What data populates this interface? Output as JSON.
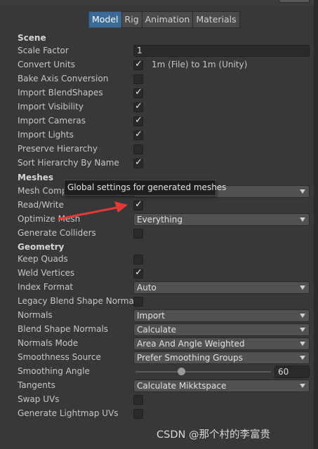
{
  "tabs": [
    {
      "label": "Model",
      "active": true
    },
    {
      "label": "Rig",
      "active": false
    },
    {
      "label": "Animation",
      "active": false
    },
    {
      "label": "Materials",
      "active": false
    }
  ],
  "scene": {
    "header": "Scene",
    "scale_factor_label": "Scale Factor",
    "scale_factor_value": "1",
    "convert_units_label": "Convert Units",
    "convert_units_checked": true,
    "convert_units_note": "1m (File) to 1m (Unity)",
    "bake_axis_label": "Bake Axis Conversion",
    "bake_axis_checked": false,
    "import_blendshapes_label": "Import BlendShapes",
    "import_blendshapes_checked": true,
    "import_visibility_label": "Import Visibility",
    "import_visibility_checked": true,
    "import_cameras_label": "Import Cameras",
    "import_cameras_checked": true,
    "import_lights_label": "Import Lights",
    "import_lights_checked": true,
    "preserve_hierarchy_label": "Preserve Hierarchy",
    "preserve_hierarchy_checked": false,
    "sort_hierarchy_label": "Sort Hierarchy By Name",
    "sort_hierarchy_checked": true
  },
  "meshes": {
    "header": "Meshes",
    "mesh_compression_label": "Mesh Comp",
    "mesh_compression_value": "",
    "read_write_label": "Read/Write",
    "read_write_checked": true,
    "optimize_mesh_label": "Optimize Mesh",
    "optimize_mesh_value": "Everything",
    "generate_colliders_label": "Generate Colliders",
    "generate_colliders_checked": false
  },
  "tooltip": {
    "text": "Global settings for generated meshes"
  },
  "geometry": {
    "header": "Geometry",
    "keep_quads_label": "Keep Quads",
    "keep_quads_checked": false,
    "weld_vertices_label": "Weld Vertices",
    "weld_vertices_checked": true,
    "index_format_label": "Index Format",
    "index_format_value": "Auto",
    "legacy_blend_label": "Legacy Blend Shape Normals",
    "legacy_blend_checked": false,
    "normals_label": "Normals",
    "normals_value": "Import",
    "blend_shape_normals_label": "Blend Shape Normals",
    "blend_shape_normals_value": "Calculate",
    "normals_mode_label": "Normals Mode",
    "normals_mode_value": "Area And Angle Weighted",
    "smoothness_source_label": "Smoothness Source",
    "smoothness_source_value": "Prefer Smoothing Groups",
    "smoothing_angle_label": "Smoothing Angle",
    "smoothing_angle_value": "60",
    "smoothing_angle_fraction": 0.333,
    "tangents_label": "Tangents",
    "tangents_value": "Calculate Mikktspace",
    "swap_uvs_label": "Swap UVs",
    "swap_uvs_checked": false,
    "lightmap_uvs_label": "Generate Lightmap UVs",
    "lightmap_uvs_checked": false
  },
  "watermark": "CSDN @那个村的李富贵",
  "colors": {
    "background": "#383838",
    "active_tab": "#3c6a96",
    "annotation_arrow": "#e53935"
  }
}
